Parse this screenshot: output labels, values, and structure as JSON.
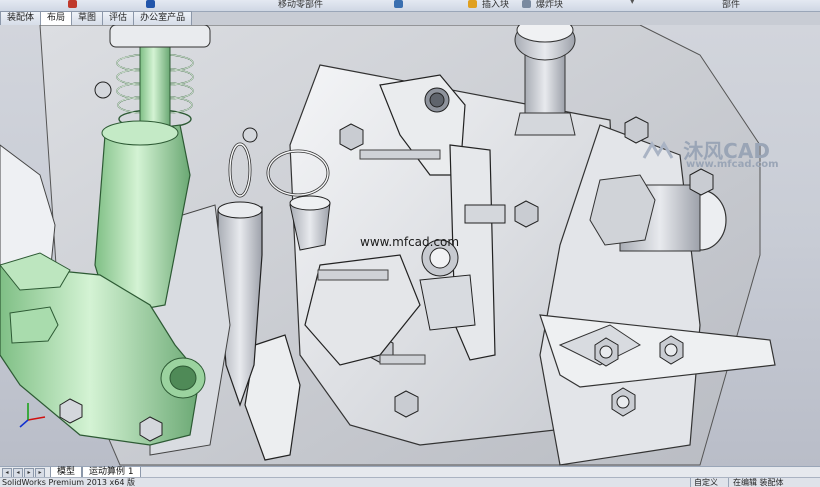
{
  "toolbar": {
    "move_component_label": "移动零部件",
    "insert_block_label": "插入块",
    "make_block_label": "爆炸块",
    "doc_type_label": "部件"
  },
  "command_tabs": [
    {
      "label": "装配体"
    },
    {
      "label": "布局"
    },
    {
      "label": "草图"
    },
    {
      "label": "评估"
    },
    {
      "label": "办公室产品"
    }
  ],
  "watermark": {
    "logo_text": "沐风CAD",
    "logo_url_text": "www.mfcad.com",
    "center_url": "www.mfcad.com"
  },
  "sheet_tabs": [
    {
      "label": "模型"
    },
    {
      "label": "运动算例 1"
    }
  ],
  "status": {
    "version_text": "SolidWorks Premium 2013 x64 版",
    "custom_text": "自定义",
    "editing_text": "在编辑 装配体"
  },
  "colors": {
    "part_green": "#b4e4b4",
    "part_gray": "#e9ebee",
    "background": "#c8ccd4",
    "tab_border": "#8c98aa"
  }
}
